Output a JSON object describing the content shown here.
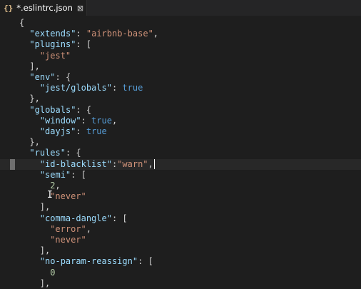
{
  "tab": {
    "icon": "{}",
    "title": "*.eslintrc.json",
    "close_glyph": "⊠"
  },
  "lines": [
    {
      "tokens": [
        [
          "p",
          "{"
        ]
      ]
    },
    {
      "tokens": [
        [
          "k",
          "\"extends\""
        ],
        [
          "p",
          ": "
        ],
        [
          "s",
          "\"airbnb-base\""
        ],
        [
          "p",
          ","
        ]
      ]
    },
    {
      "tokens": [
        [
          "k",
          "\"plugins\""
        ],
        [
          "p",
          ": ["
        ]
      ]
    },
    {
      "tokens": [
        [
          "s",
          "\"jest\""
        ]
      ]
    },
    {
      "tokens": [
        [
          "p",
          "],"
        ]
      ]
    },
    {
      "tokens": [
        [
          "k",
          "\"env\""
        ],
        [
          "p",
          ": {"
        ]
      ]
    },
    {
      "tokens": [
        [
          "k",
          "\"jest/globals\""
        ],
        [
          "p",
          ": "
        ],
        [
          "b",
          "true"
        ]
      ]
    },
    {
      "tokens": [
        [
          "p",
          "},"
        ]
      ]
    },
    {
      "tokens": [
        [
          "k",
          "\"globals\""
        ],
        [
          "p",
          ": {"
        ]
      ]
    },
    {
      "tokens": [
        [
          "k",
          "\"window\""
        ],
        [
          "p",
          ": "
        ],
        [
          "b",
          "true"
        ],
        [
          "p",
          ","
        ]
      ]
    },
    {
      "tokens": [
        [
          "k",
          "\"dayjs\""
        ],
        [
          "p",
          ": "
        ],
        [
          "b",
          "true"
        ]
      ]
    },
    {
      "tokens": [
        [
          "p",
          "},"
        ]
      ]
    },
    {
      "tokens": [
        [
          "k",
          "\"rules\""
        ],
        [
          "p",
          ": {"
        ]
      ]
    },
    {
      "tokens": [
        [
          "k",
          "\"id-blacklist\""
        ],
        [
          "p",
          ":"
        ],
        [
          "s",
          "\"warn\""
        ],
        [
          "p",
          ","
        ]
      ],
      "current": true
    },
    {
      "tokens": [
        [
          "k",
          "\"semi\""
        ],
        [
          "p",
          ": ["
        ]
      ]
    },
    {
      "tokens": [
        [
          "n",
          "2"
        ],
        [
          "p",
          ","
        ]
      ]
    },
    {
      "tokens": [
        [
          "s",
          "\"never\""
        ]
      ]
    },
    {
      "tokens": [
        [
          "p",
          "],"
        ]
      ]
    },
    {
      "tokens": [
        [
          "k",
          "\"comma-dangle\""
        ],
        [
          "p",
          ": ["
        ]
      ]
    },
    {
      "tokens": [
        [
          "s",
          "\"error\""
        ],
        [
          "p",
          ","
        ]
      ]
    },
    {
      "tokens": [
        [
          "s",
          "\"never\""
        ]
      ]
    },
    {
      "tokens": [
        [
          "p",
          "],"
        ]
      ]
    },
    {
      "tokens": [
        [
          "k",
          "\"no-param-reassign\""
        ],
        [
          "p",
          ": ["
        ]
      ]
    },
    {
      "tokens": [
        [
          "n",
          "0"
        ]
      ]
    },
    {
      "tokens": [
        [
          "p",
          "],"
        ]
      ]
    }
  ]
}
